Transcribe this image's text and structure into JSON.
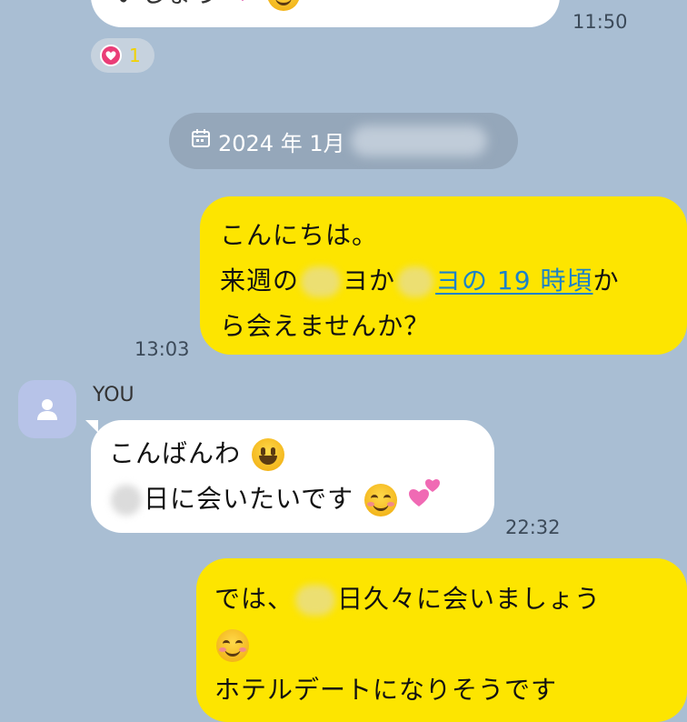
{
  "colors": {
    "background": "#a9bed3",
    "outgoing_bubble": "#fde500",
    "incoming_bubble": "#ffffff",
    "link": "#1b82c8",
    "reaction_heart": "#ea3d77"
  },
  "top_message": {
    "partial_text": "いしょう",
    "time": "11:50",
    "emojis": [
      "heart-emoji",
      "smiling-face-with-hearts-emoji"
    ]
  },
  "reaction": {
    "icon": "heart-icon",
    "count": "1"
  },
  "date_separator": {
    "icon": "calendar-icon",
    "text": "2024 年 1月"
  },
  "messages": [
    {
      "direction": "outgoing",
      "line1": "こんにちは。",
      "line2_prefix": "来週の",
      "line2_mid": "ヨか",
      "line2_link": "ヨの 19 時頃",
      "line2_suffix": "か",
      "line3": "ら会えませんか？",
      "time": "13:03"
    },
    {
      "direction": "incoming",
      "sender": "YOU",
      "line1": "こんばんわ",
      "line2": "日に会いたいです",
      "emojis": [
        "grinning-face-emoji",
        "smiling-face-emoji",
        "two-hearts-emoji"
      ],
      "time": "22:32"
    },
    {
      "direction": "outgoing",
      "line1_prefix": "では、",
      "line1_suffix": "日久々に会いましょう",
      "line3": "ホテルデートになりそうです",
      "emojis": [
        "smiling-face-with-hearts-emoji"
      ]
    }
  ]
}
